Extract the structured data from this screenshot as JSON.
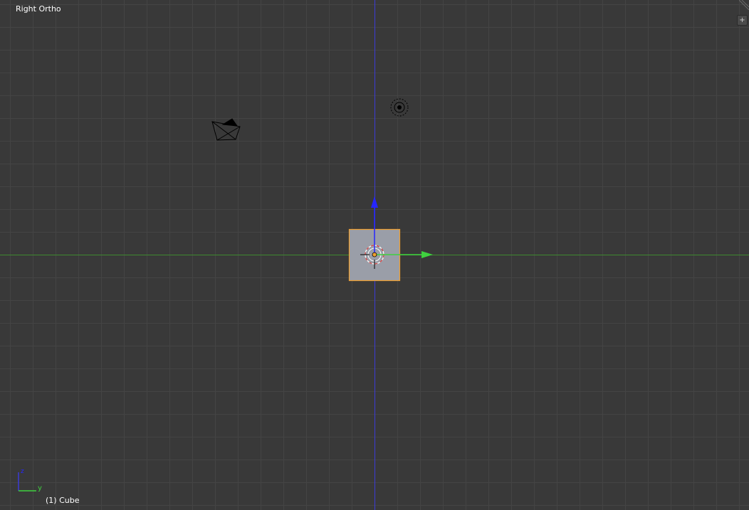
{
  "viewport": {
    "view_name": "Right Ortho",
    "object_info": "(1) Cube",
    "axis_widget": {
      "vertical_label": "z",
      "horizontal_label": "y"
    },
    "corner_button_label": "+"
  },
  "colors": {
    "background": "#393939",
    "grid_line": "#444444",
    "y_axis_line": "#3d8a2e",
    "z_axis_line": "#3b3bd6",
    "selected_outline": "#f0a030",
    "cube_fill": "#9a9ea8",
    "gizmo_green": "#3fd13f",
    "gizmo_blue": "#2626ff"
  },
  "objects": {
    "camera": "camera-icon",
    "lamp": "lamp-icon",
    "cube": "Cube"
  }
}
